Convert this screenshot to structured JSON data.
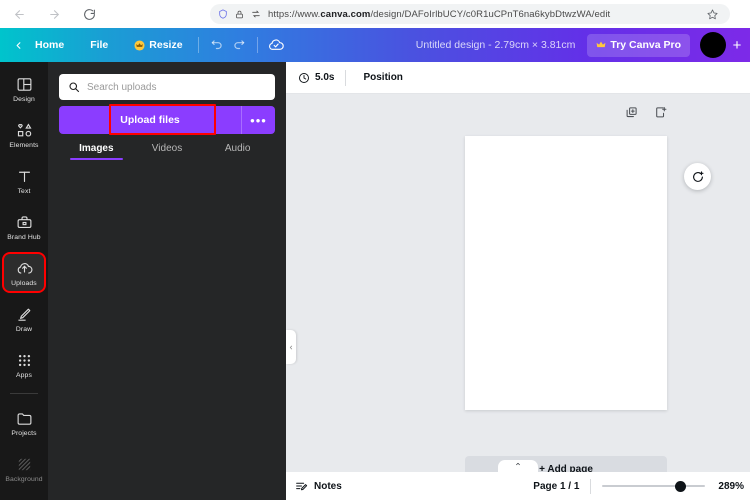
{
  "browser": {
    "back_icon": "arrow-left-icon",
    "forward_icon": "arrow-right-icon",
    "reload_icon": "reload-icon",
    "shield_icon": "shield-icon",
    "lock_icon": "lock-icon",
    "permissions_icon": "permissions-icon",
    "bookmark_icon": "star-icon",
    "url_prefix": "https://www.",
    "url_domain": "canva.com",
    "url_path": "/design/DAFoIrlbUCY/c0R1uCPnT6na6kybDtwzWA/edit"
  },
  "header": {
    "back_label": "",
    "home_label": "Home",
    "file_label": "File",
    "resize_label": "Resize",
    "crown_icon": "crown-icon",
    "undo_icon": "undo-icon",
    "redo_icon": "redo-icon",
    "cloud_icon": "cloud-sync-icon",
    "design_title": "Untitled design - 2.79cm × 3.81cm",
    "try_pro_label": "Try Canva Pro",
    "try_pro_crown_icon": "crown-icon",
    "avatar": "user-avatar",
    "plus_label": "+",
    "gradient_start": "#00c4cc",
    "gradient_end": "#7d2ae8"
  },
  "rail": {
    "items": [
      {
        "label": "Design",
        "icon": "layout-icon",
        "active": false,
        "highlighted": false
      },
      {
        "label": "Elements",
        "icon": "shapes-icon",
        "active": false,
        "highlighted": false
      },
      {
        "label": "Text",
        "icon": "text-t-icon",
        "active": false,
        "highlighted": false
      },
      {
        "label": "Brand Hub",
        "icon": "briefcase-icon",
        "active": false,
        "highlighted": false
      },
      {
        "label": "Uploads",
        "icon": "upload-cloud-icon",
        "active": true,
        "highlighted": true
      },
      {
        "label": "Draw",
        "icon": "pen-icon",
        "active": false,
        "highlighted": false
      },
      {
        "label": "Apps",
        "icon": "grid-dots-icon",
        "active": false,
        "highlighted": false
      },
      {
        "label": "Projects",
        "icon": "folder-icon",
        "active": false,
        "highlighted": false
      },
      {
        "label": "Background",
        "icon": "hatch-pattern-icon",
        "active": false,
        "highlighted": false
      }
    ],
    "highlight_color": "#ff0000"
  },
  "panel": {
    "search_placeholder": "Search uploads",
    "search_value": "",
    "search_icon": "search-icon",
    "upload_button_label": "Upload files",
    "upload_more_label": "•••",
    "upload_accent_color": "#8b3dff",
    "highlight_color": "#ff0000",
    "tabs": [
      {
        "label": "Images",
        "active": true
      },
      {
        "label": "Videos",
        "active": false
      },
      {
        "label": "Audio",
        "active": false
      }
    ],
    "collapse_icon": "chevron-left-icon"
  },
  "editor": {
    "duration_label": "5.0s",
    "clock_icon": "clock-icon",
    "position_label": "Position",
    "duplicate_page_icon": "duplicate-page-icon",
    "add-page_icon": "add-page-icon",
    "animate_icon": "animate-refresh-icon",
    "add_page_label": "+ Add page",
    "expand_icon": "chevron-up-icon"
  },
  "status": {
    "notes_label": "Notes",
    "notes_icon": "notes-pencil-icon",
    "page_count_label": "Page 1 / 1",
    "zoom_value": "289%",
    "zoom_percent": 76
  }
}
